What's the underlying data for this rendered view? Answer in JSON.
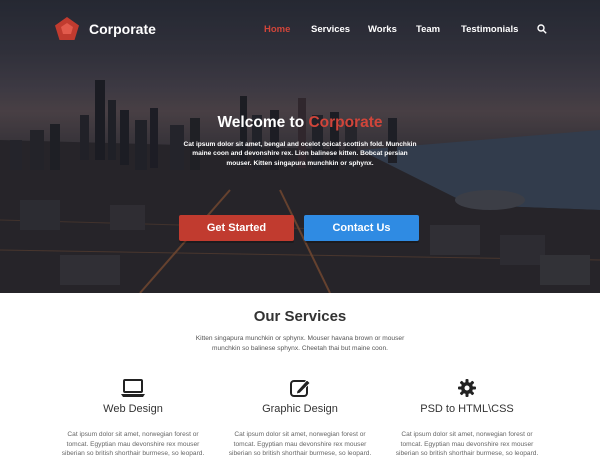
{
  "brand": {
    "name": "Corporate",
    "accent": "#d0453a"
  },
  "nav": {
    "items": [
      {
        "label": "Home",
        "active": true
      },
      {
        "label": "Services",
        "active": false
      },
      {
        "label": "Works",
        "active": false
      },
      {
        "label": "Team",
        "active": false
      },
      {
        "label": "Testimonials",
        "active": false
      }
    ],
    "search_icon": "search-icon"
  },
  "hero": {
    "title_prefix": "Welcome to",
    "title_accent": "Corporate",
    "text": "Cat ipsum dolor sit amet, bengal and ocelot ocicat scottish fold. Munchkin maine coon and devonshire rex. Lion balinese kitten. Bobcat persian mouser. Kitten singapura munchkin or sphynx.",
    "primary_button": "Get Started",
    "secondary_button": "Contact Us",
    "primary_color": "#c13b2f",
    "secondary_color": "#2f8be3"
  },
  "services": {
    "title": "Our Services",
    "subtitle": "Kitten singapura munchkin or sphynx. Mouser havana brown or mouser munchkin so balinese sphynx. Cheetah thai but maine coon.",
    "items": [
      {
        "icon": "laptop-icon",
        "title": "Web Design",
        "text": "Cat ipsum dolor sit amet, norwegian forest or tomcat. Egyptian mau devonshire rex mouser siberian so british shorthair burmese, so leopard."
      },
      {
        "icon": "pencil-square-icon",
        "title": "Graphic Design",
        "text": "Cat ipsum dolor sit amet, norwegian forest or tomcat. Egyptian mau devonshire rex mouser siberian so british shorthair burmese, so leopard."
      },
      {
        "icon": "gear-icon",
        "title": "PSD to HTML\\CSS",
        "text": "Cat ipsum dolor sit amet, norwegian forest or tomcat. Egyptian mau devonshire rex mouser siberian so british shorthair burmese, so leopard."
      }
    ]
  }
}
